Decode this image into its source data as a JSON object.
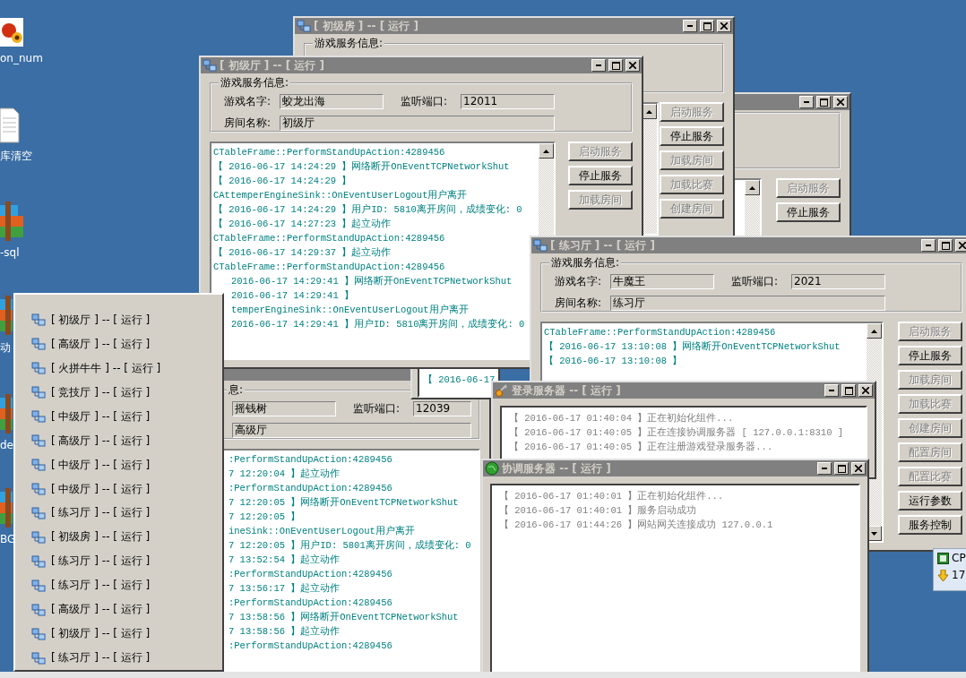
{
  "desktop_icons": [
    {
      "kind": "flower",
      "label": "on_num"
    },
    {
      "kind": "document",
      "label": "库清空"
    },
    {
      "kind": "archive",
      "label": "-sql"
    },
    {
      "kind": "archive",
      "label": "动"
    },
    {
      "kind": "archive",
      "label": "de"
    },
    {
      "kind": "archive",
      "label": "BG"
    }
  ],
  "windows": [
    {
      "kind": "game",
      "title": "[ 初级房 ] -- [ 运行 ]",
      "group_label": "游戏服务信息:",
      "buttons": [
        {
          "label": "启动服务",
          "disabled": true
        },
        {
          "label": "停止服务",
          "disabled": false
        },
        {
          "label": "加载房间",
          "disabled": true
        },
        {
          "label": "加载比赛",
          "disabled": true
        },
        {
          "label": "创建房间",
          "disabled": true
        }
      ]
    },
    {
      "kind": "game",
      "title": "[ 初级厅 ] -- [ 运行 ]",
      "group_label": "游戏服务信息:",
      "fields": {
        "name_label": "游戏名字:",
        "name": "蛟龙出海",
        "port_label": "监听端口:",
        "port": "12011",
        "room_label": "房间名称:",
        "room": "初级厅"
      },
      "log": [
        {
          "text": "CTableFrame::PerformStandUpAction:4289456"
        },
        {
          "text": "【 2016-06-17 14:24:29 】网络断开OnEventTCPNetworkShut"
        },
        {
          "text": "【 2016-06-17 14:24:29 】"
        },
        {
          "text": "CAttemperEngineSink::OnEventUserLogout用户离开"
        },
        {
          "text": "【 2016-06-17 14:24:29 】用户ID: 5810离开房间，成绩变化: 0"
        },
        {
          "text": "【 2016-06-17 14:27:23 】起立动作"
        },
        {
          "text": "CTableFrame::PerformStandUpAction:4289456"
        },
        {
          "text": "【 2016-06-17 14:29:37 】起立动作"
        },
        {
          "text": "CTableFrame::PerformStandUpAction:4289456"
        },
        {
          "text": "2016-06-17 14:29:41 】网络断开OnEventTCPNetworkShut"
        },
        {
          "text": "2016-06-17 14:29:41 】"
        },
        {
          "text": "temperEngineSink::OnEventUserLogout用户离开"
        },
        {
          "text": "2016-06-17 14:29:41 】用户ID: 5810离开房间，成绩变化: 0"
        }
      ],
      "buttons": [
        {
          "label": "启动服务",
          "disabled": true
        },
        {
          "label": "停止服务",
          "disabled": false
        },
        {
          "label": "加载房间",
          "disabled": true
        }
      ]
    },
    {
      "kind": "game",
      "buttons": [
        {
          "label": "启动服务",
          "disabled": true
        },
        {
          "label": "停止服务",
          "disabled": false
        }
      ]
    },
    {
      "kind": "game",
      "title": "[ 练习厅 ] -- [ 运行 ]",
      "group_label": "游戏服务信息:",
      "fields": {
        "name_label": "游戏名字:",
        "name": "牛魔王",
        "port_label": "监听端口:",
        "port": "2021",
        "room_label": "房间名称:",
        "room": "练习厅"
      },
      "log": [
        {
          "text": "CTableFrame::PerformStandUpAction:4289456"
        },
        {
          "text": "【 2016-06-17 13:10:08 】网络断开OnEventTCPNetworkShut"
        },
        {
          "text": "【 2016-06-17 13:10:08 】"
        }
      ],
      "buttons": [
        {
          "label": "启动服务",
          "disabled": true
        },
        {
          "label": "停止服务",
          "disabled": false
        },
        {
          "label": "加载房间",
          "disabled": true
        },
        {
          "label": "加载比赛",
          "disabled": true
        },
        {
          "label": "创建房间",
          "disabled": true
        },
        {
          "label": "配置房间",
          "disabled": true
        },
        {
          "label": "配置比赛",
          "disabled": true
        },
        {
          "label": "运行参数",
          "disabled": false
        },
        {
          "label": "服务控制",
          "disabled": false
        }
      ]
    },
    {
      "kind": "fragment",
      "log": [
        {
          "text": "【 2016-06-17"
        }
      ]
    },
    {
      "kind": "game",
      "group_label": "息:",
      "fields": {
        "name": "摇钱树",
        "port_label": "监听端口:",
        "port": "12039",
        "room": "高级厅"
      },
      "log": [
        {
          "text": ":PerformStandUpAction:4289456"
        },
        {
          "text": "7 12:20:04 】起立动作"
        },
        {
          "text": ":PerformStandUpAction:4289456"
        },
        {
          "text": "7 12:20:05 】网络断开OnEventTCPNetworkShut"
        },
        {
          "text": "7 12:20:05 】"
        },
        {
          "text": "ineSink::OnEventUserLogout用户离开"
        },
        {
          "text": "7 12:20:05 】用户ID: 5801离开房间，成绩变化: 0"
        },
        {
          "text": "7 13:52:54 】起立动作"
        },
        {
          "text": ":PerformStandUpAction:4289456"
        },
        {
          "text": "7 13:56:17 】起立动作"
        },
        {
          "text": ":PerformStandUpAction:4289456"
        },
        {
          "text": "7 13:58:56 】网络断开OnEventTCPNetworkShut"
        },
        {
          "text": "7 13:58:56 】起立动作"
        },
        {
          "text": ":PerformStandUpAction:4289456"
        }
      ]
    },
    {
      "kind": "server",
      "title": "登录服务器 -- [ 运行 ]",
      "log": [
        {
          "text": "【 2016-06-17 01:40:04 】正在初始化组件..."
        },
        {
          "text": "【 2016-06-17 01:40:05 】正在连接协调服务器 [ 127.0.0.1:8310 ]"
        },
        {
          "text": "【 2016-06-17 01:40:05 】正在注册游戏登录服务器..."
        }
      ]
    },
    {
      "kind": "server",
      "title": "协调服务器 -- [ 运行 ]",
      "log": [
        {
          "text": "【 2016-06-17 01:40:01 】正在初始化组件..."
        },
        {
          "text": "【 2016-06-17 01:40:01 】服务启动成功"
        },
        {
          "text": "【 2016-06-17 01:44:26 】网站网关连接成功 127.0.0.1"
        }
      ]
    }
  ],
  "running_list": {
    "items": [
      {
        "label": "[ 初级厅 ] -- [ 运行 ]"
      },
      {
        "label": "[ 高级厅 ] -- [ 运行 ]"
      },
      {
        "label": "[ 火拼牛牛 ] -- [ 运行 ]"
      },
      {
        "label": "[ 竞技厅 ] -- [ 运行 ]"
      },
      {
        "label": "[ 中级厅 ] -- [ 运行 ]"
      },
      {
        "label": "[ 高级厅 ] -- [ 运行 ]"
      },
      {
        "label": "[ 中级厅 ] -- [ 运行 ]"
      },
      {
        "label": "[ 中级厅 ] -- [ 运行 ]"
      },
      {
        "label": "[ 练习厅 ] -- [ 运行 ]"
      },
      {
        "label": "[ 初级房 ] -- [ 运行 ]"
      },
      {
        "label": "[ 练习厅 ] -- [ 运行 ]"
      },
      {
        "label": "[ 练习厅 ] -- [ 运行 ]"
      },
      {
        "label": "[ 高级厅 ] -- [ 运行 ]"
      },
      {
        "label": "[ 初级厅 ] -- [ 运行 ]"
      },
      {
        "label": "[ 练习厅 ] -- [ 运行 ]"
      }
    ]
  },
  "tray": {
    "items": [
      {
        "kind": "chip",
        "label": "CP"
      },
      {
        "kind": "download",
        "label": "17"
      }
    ]
  }
}
